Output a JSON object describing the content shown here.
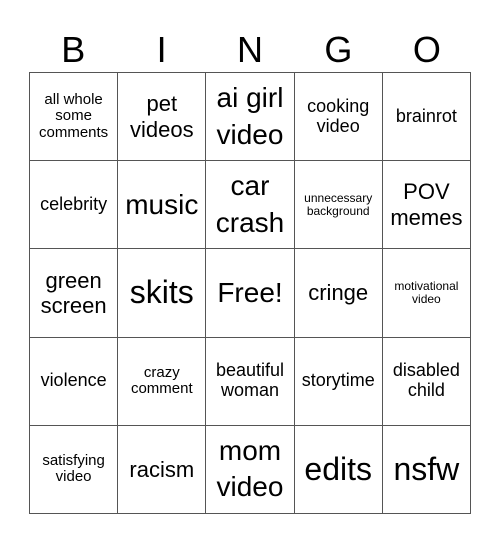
{
  "header": {
    "letters": [
      "B",
      "I",
      "N",
      "G",
      "O"
    ]
  },
  "cells": [
    [
      "all whole some comments",
      "pet videos",
      "ai girl video",
      "cooking video",
      "brainrot"
    ],
    [
      "celebrity",
      "music",
      "car crash",
      "unnecessary background",
      "POV memes"
    ],
    [
      "green screen",
      "skits",
      "Free!",
      "cringe",
      "motivational video"
    ],
    [
      "violence",
      "crazy comment",
      "beautiful woman",
      "storytime",
      "disabled child"
    ],
    [
      "satisfying video",
      "racism",
      "mom video",
      "edits",
      "nsfw"
    ]
  ]
}
